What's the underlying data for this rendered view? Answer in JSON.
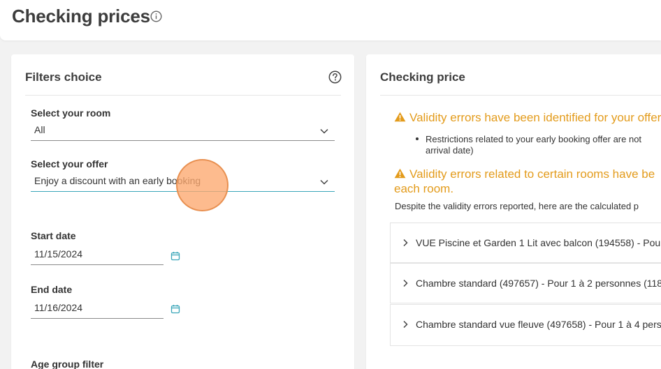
{
  "header": {
    "title": "Checking prices"
  },
  "filters": {
    "title": "Filters choice",
    "room": {
      "label": "Select your room",
      "value": "All"
    },
    "offer": {
      "label": "Select your offer",
      "value": "Enjoy a discount with an early booking"
    },
    "start_date": {
      "label": "Start date",
      "value": "11/15/2024"
    },
    "end_date": {
      "label": "End date",
      "value": "11/16/2024"
    },
    "age_group": {
      "label": "Age group filter"
    }
  },
  "checking": {
    "title": "Checking price",
    "warning1": "Validity errors have been identified for your offer",
    "bullet1_line1": "Restrictions related to your early booking offer are not",
    "bullet1_line2": "arrival date)",
    "warning2_line1": "Validity errors related to certain rooms have be",
    "warning2_line2": "each room.",
    "note": "Despite the validity errors reported, here are the calculated p",
    "rooms": [
      {
        "label": "VUE Piscine et Garden 1 Lit avec balcon (194558) - Pour"
      },
      {
        "label": "Chambre standard (497657) - Pour 1 à 2 personnes (118"
      },
      {
        "label": "Chambre standard vue fleuve (497658) - Pour 1 à 4 pers"
      }
    ]
  },
  "colors": {
    "accent": "#3aa6b9",
    "warning": "#e39b1b",
    "click_marker": "#fca86e"
  }
}
